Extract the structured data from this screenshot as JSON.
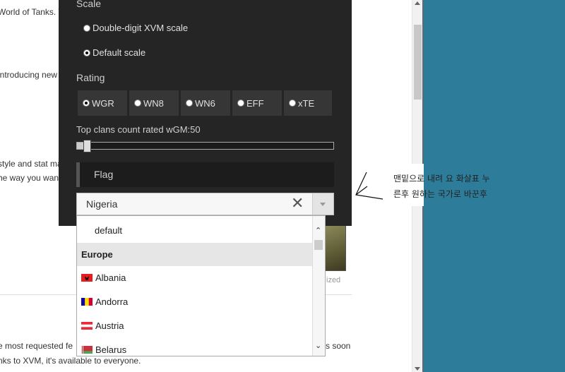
{
  "background_page": {
    "lines": [
      "World of Tanks. T",
      " introducing new",
      "style and stat ma",
      "he way you wan",
      "e most requested fe",
      "nks to XVM, it's available to everyone."
    ],
    "right_fragment": "s soon",
    "caption": "ized"
  },
  "panel": {
    "scale_title": "Scale",
    "scale_options": [
      "Double-digit XVM scale",
      "Default scale"
    ],
    "rating_title": "Rating",
    "rating_options": [
      "WGR",
      "WN8",
      "WN6",
      "EFF",
      "xTE"
    ],
    "clans_label": "Top clans count rated wGM:50",
    "flag_title": "Flag"
  },
  "select": {
    "value": "Nigeria",
    "clear_symbol": "✕"
  },
  "dropdown": {
    "default_option": "default",
    "group": "Europe",
    "countries": [
      "Albania",
      "Andorra",
      "Austria",
      "Belarus"
    ]
  },
  "annotation": {
    "line1": "맨밑으로 내려 요 화살표 누",
    "line2": "른후 원하는 국가로 바꾼후"
  },
  "colors": {
    "panel_bg": "#252525",
    "desktop": "#2d7d9a"
  }
}
